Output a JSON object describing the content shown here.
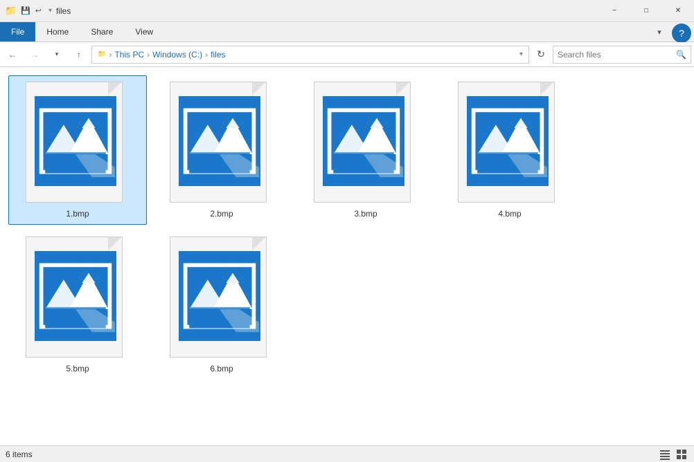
{
  "titlebar": {
    "title": "files",
    "minimize_label": "−",
    "maximize_label": "□",
    "close_label": "✕"
  },
  "ribbon": {
    "tabs": [
      "File",
      "Home",
      "Share",
      "View"
    ]
  },
  "addressbar": {
    "back_tooltip": "Back",
    "forward_tooltip": "Forward",
    "up_tooltip": "Up",
    "path_parts": [
      "This PC",
      "Windows (C:)",
      "files"
    ],
    "refresh_tooltip": "Refresh",
    "search_placeholder": "Search files"
  },
  "files": [
    {
      "name": "1.bmp",
      "selected": true
    },
    {
      "name": "2.bmp",
      "selected": false
    },
    {
      "name": "3.bmp",
      "selected": false
    },
    {
      "name": "4.bmp",
      "selected": false
    },
    {
      "name": "5.bmp",
      "selected": false
    },
    {
      "name": "6.bmp",
      "selected": false
    }
  ],
  "statusbar": {
    "item_count": "6 items"
  },
  "colors": {
    "accent": "#1a6fb5",
    "image_blue": "#1a77c9"
  }
}
